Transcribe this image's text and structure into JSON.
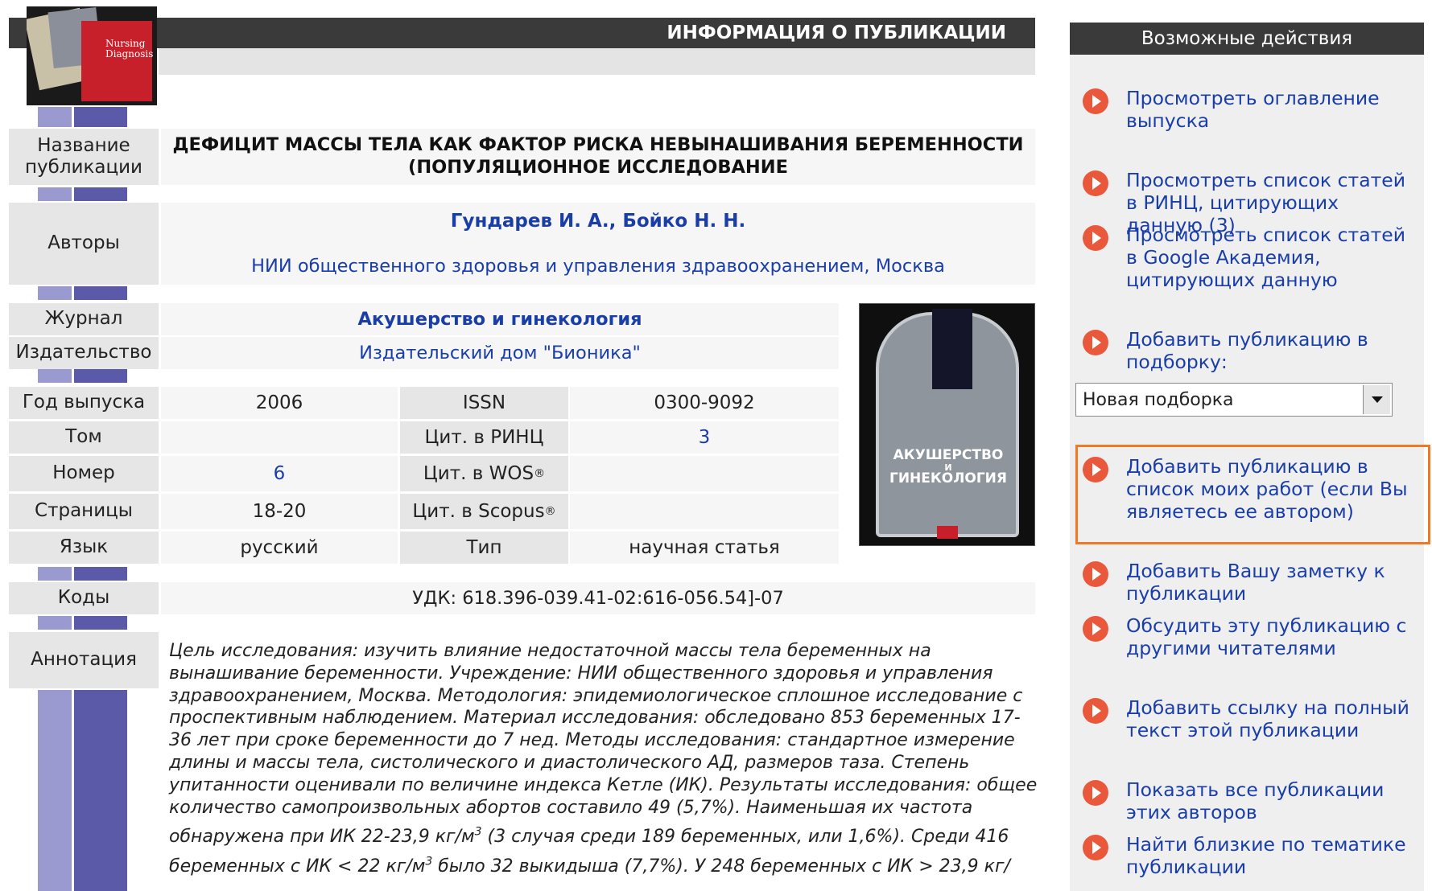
{
  "header": {
    "title": "ИНФОРМАЦИЯ О ПУБЛИКАЦИИ"
  },
  "publication": {
    "title_label": "Название публикации",
    "title_line1": "ДЕФИЦИТ МАССЫ ТЕЛА КАК ФАКТОР РИСКА НЕВЫНАШИВАНИЯ БЕРЕМЕННОСТИ",
    "title_line2": "(ПОПУЛЯЦИОННОЕ ИССЛЕДОВАНИЕ",
    "authors_label": "Авторы",
    "authors": "Гундарев И. А., Бойко Н. Н.",
    "affiliation": "НИИ общественного здоровья и управления здравоохранением, Москва",
    "journal_label": "Журнал",
    "journal": "Акушерство и гинекология",
    "publisher_label": "Издательство",
    "publisher": "Издательский дом \"Бионика\"",
    "year_label": "Год выпуска",
    "year": "2006",
    "volume_label": "Том",
    "volume": "",
    "issue_label": "Номер",
    "issue": "6",
    "pages_label": "Страницы",
    "pages": "18-20",
    "language_label": "Язык",
    "language": "русский",
    "issn_label": "ISSN",
    "issn": "0300-9092",
    "rinc_label": "Цит. в РИНЦ",
    "rinc": "3",
    "wos_label": "Цит. в WOS",
    "wos_sup": "®",
    "scopus_label": "Цит. в Scopus",
    "scopus_sup": "®",
    "type_label": "Тип",
    "type": "научная статья",
    "codes_label": "Коды",
    "codes": "УДК: 618.396-039.41-02:616-056.54]-07",
    "abstract_label": "Аннотация",
    "abstract_lines": [
      "Цель исследования: изучить влияние недостаточной массы тела беременных на",
      "вынашивание беременности. Учреждение: НИИ общественного здоровья и управления",
      "здравоохранением, Москва. Методология: эпидемиологическое сплошное исследование с",
      "проспективным наблюдением. Материал исследования: обследовано 853 беременных 17-",
      "36 лет при сроке беременности до 7 нед. Методы исследования: стандартное измерение",
      "длины и массы тела, систолического и диастолического АД, размеров таза. Степень",
      "упитанности оценивали по величине индекса Кетле (ИК). Результаты исследования: общее",
      "количество самопроизвольных абортов составило 49 (5,7%). Наименьшая их частота"
    ],
    "abstract_line9_a": "обнаружена при ИК 22-23,9 кг/м",
    "abstract_line9_sup": "3",
    "abstract_line9_b": " (3 случая среди 189 беременных, или 1,6%). Среди 416",
    "abstract_line10_a": "беременных с ИК < 22 кг/м",
    "abstract_line10_sup": "3",
    "abstract_line10_b": " было 32 выкидыша (7,7%). У 248 беременных с ИК > 23,9 кг/"
  },
  "cover": {
    "text_line1": "АКУШЕРСТВО",
    "text_line2": "И",
    "text_line3": "ГИНЕКОЛОГИЯ"
  },
  "logo": {
    "text_line1": "Nursing",
    "text_line2": "Diagnosis"
  },
  "actions": {
    "title": "Возможные действия",
    "items": [
      "Просмотреть оглавление выпуска",
      "Просмотреть список статей в РИНЦ, цитирующих данную (3)",
      "Просмотреть список статей в Google Академия, цитирующих данную",
      "Добавить публикацию в подборку:",
      "Добавить публикацию в список моих работ (если Вы являетесь ее автором)",
      "Добавить Вашу заметку к публикации",
      "Обсудить эту публикацию с другими читателями",
      "Добавить ссылку на полный текст этой публикации",
      "Показать все публикации этих авторов",
      "Найти близкие по тематике публикации"
    ],
    "select_value": "Новая подборка"
  },
  "colors": {
    "header_bg": "#3a3a3a",
    "link": "#1a3ea8",
    "icon": "#e9583a",
    "highlight": "#f07a24"
  }
}
